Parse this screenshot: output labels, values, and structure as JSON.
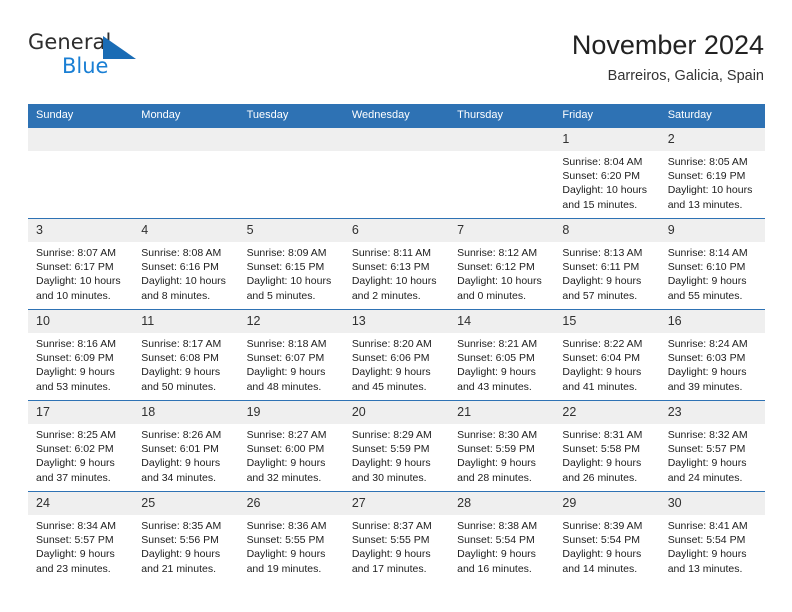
{
  "brand": {
    "name_top": "General",
    "name_bottom": "Blue",
    "triangle_icon": "triangle-logo-icon",
    "color_top": "#2d2d2d",
    "color_bottom": "#1a7fd4",
    "color_triangle": "#1a6cb5"
  },
  "header": {
    "title": "November 2024",
    "subtitle": "Barreiros, Galicia, Spain"
  },
  "theme": {
    "header_blue": "#2e72b4",
    "daynum_gray": "#efefef",
    "cell_white": "#ffffff",
    "text_dark": "#1d1d1d"
  },
  "weekday_headers": [
    "Sunday",
    "Monday",
    "Tuesday",
    "Wednesday",
    "Thursday",
    "Friday",
    "Saturday"
  ],
  "weeks": [
    {
      "days": [
        {
          "empty": true,
          "num": "",
          "sunrise": "",
          "sunset": "",
          "daylight_1": "",
          "daylight_2": ""
        },
        {
          "empty": true,
          "num": "",
          "sunrise": "",
          "sunset": "",
          "daylight_1": "",
          "daylight_2": ""
        },
        {
          "empty": true,
          "num": "",
          "sunrise": "",
          "sunset": "",
          "daylight_1": "",
          "daylight_2": ""
        },
        {
          "empty": true,
          "num": "",
          "sunrise": "",
          "sunset": "",
          "daylight_1": "",
          "daylight_2": ""
        },
        {
          "empty": true,
          "num": "",
          "sunrise": "",
          "sunset": "",
          "daylight_1": "",
          "daylight_2": ""
        },
        {
          "empty": false,
          "num": "1",
          "sunrise": "Sunrise: 8:04 AM",
          "sunset": "Sunset: 6:20 PM",
          "daylight_1": "Daylight: 10 hours",
          "daylight_2": "and 15 minutes."
        },
        {
          "empty": false,
          "num": "2",
          "sunrise": "Sunrise: 8:05 AM",
          "sunset": "Sunset: 6:19 PM",
          "daylight_1": "Daylight: 10 hours",
          "daylight_2": "and 13 minutes."
        }
      ]
    },
    {
      "days": [
        {
          "empty": false,
          "num": "3",
          "sunrise": "Sunrise: 8:07 AM",
          "sunset": "Sunset: 6:17 PM",
          "daylight_1": "Daylight: 10 hours",
          "daylight_2": "and 10 minutes."
        },
        {
          "empty": false,
          "num": "4",
          "sunrise": "Sunrise: 8:08 AM",
          "sunset": "Sunset: 6:16 PM",
          "daylight_1": "Daylight: 10 hours",
          "daylight_2": "and 8 minutes."
        },
        {
          "empty": false,
          "num": "5",
          "sunrise": "Sunrise: 8:09 AM",
          "sunset": "Sunset: 6:15 PM",
          "daylight_1": "Daylight: 10 hours",
          "daylight_2": "and 5 minutes."
        },
        {
          "empty": false,
          "num": "6",
          "sunrise": "Sunrise: 8:11 AM",
          "sunset": "Sunset: 6:13 PM",
          "daylight_1": "Daylight: 10 hours",
          "daylight_2": "and 2 minutes."
        },
        {
          "empty": false,
          "num": "7",
          "sunrise": "Sunrise: 8:12 AM",
          "sunset": "Sunset: 6:12 PM",
          "daylight_1": "Daylight: 10 hours",
          "daylight_2": "and 0 minutes."
        },
        {
          "empty": false,
          "num": "8",
          "sunrise": "Sunrise: 8:13 AM",
          "sunset": "Sunset: 6:11 PM",
          "daylight_1": "Daylight: 9 hours",
          "daylight_2": "and 57 minutes."
        },
        {
          "empty": false,
          "num": "9",
          "sunrise": "Sunrise: 8:14 AM",
          "sunset": "Sunset: 6:10 PM",
          "daylight_1": "Daylight: 9 hours",
          "daylight_2": "and 55 minutes."
        }
      ]
    },
    {
      "days": [
        {
          "empty": false,
          "num": "10",
          "sunrise": "Sunrise: 8:16 AM",
          "sunset": "Sunset: 6:09 PM",
          "daylight_1": "Daylight: 9 hours",
          "daylight_2": "and 53 minutes."
        },
        {
          "empty": false,
          "num": "11",
          "sunrise": "Sunrise: 8:17 AM",
          "sunset": "Sunset: 6:08 PM",
          "daylight_1": "Daylight: 9 hours",
          "daylight_2": "and 50 minutes."
        },
        {
          "empty": false,
          "num": "12",
          "sunrise": "Sunrise: 8:18 AM",
          "sunset": "Sunset: 6:07 PM",
          "daylight_1": "Daylight: 9 hours",
          "daylight_2": "and 48 minutes."
        },
        {
          "empty": false,
          "num": "13",
          "sunrise": "Sunrise: 8:20 AM",
          "sunset": "Sunset: 6:06 PM",
          "daylight_1": "Daylight: 9 hours",
          "daylight_2": "and 45 minutes."
        },
        {
          "empty": false,
          "num": "14",
          "sunrise": "Sunrise: 8:21 AM",
          "sunset": "Sunset: 6:05 PM",
          "daylight_1": "Daylight: 9 hours",
          "daylight_2": "and 43 minutes."
        },
        {
          "empty": false,
          "num": "15",
          "sunrise": "Sunrise: 8:22 AM",
          "sunset": "Sunset: 6:04 PM",
          "daylight_1": "Daylight: 9 hours",
          "daylight_2": "and 41 minutes."
        },
        {
          "empty": false,
          "num": "16",
          "sunrise": "Sunrise: 8:24 AM",
          "sunset": "Sunset: 6:03 PM",
          "daylight_1": "Daylight: 9 hours",
          "daylight_2": "and 39 minutes."
        }
      ]
    },
    {
      "days": [
        {
          "empty": false,
          "num": "17",
          "sunrise": "Sunrise: 8:25 AM",
          "sunset": "Sunset: 6:02 PM",
          "daylight_1": "Daylight: 9 hours",
          "daylight_2": "and 37 minutes."
        },
        {
          "empty": false,
          "num": "18",
          "sunrise": "Sunrise: 8:26 AM",
          "sunset": "Sunset: 6:01 PM",
          "daylight_1": "Daylight: 9 hours",
          "daylight_2": "and 34 minutes."
        },
        {
          "empty": false,
          "num": "19",
          "sunrise": "Sunrise: 8:27 AM",
          "sunset": "Sunset: 6:00 PM",
          "daylight_1": "Daylight: 9 hours",
          "daylight_2": "and 32 minutes."
        },
        {
          "empty": false,
          "num": "20",
          "sunrise": "Sunrise: 8:29 AM",
          "sunset": "Sunset: 5:59 PM",
          "daylight_1": "Daylight: 9 hours",
          "daylight_2": "and 30 minutes."
        },
        {
          "empty": false,
          "num": "21",
          "sunrise": "Sunrise: 8:30 AM",
          "sunset": "Sunset: 5:59 PM",
          "daylight_1": "Daylight: 9 hours",
          "daylight_2": "and 28 minutes."
        },
        {
          "empty": false,
          "num": "22",
          "sunrise": "Sunrise: 8:31 AM",
          "sunset": "Sunset: 5:58 PM",
          "daylight_1": "Daylight: 9 hours",
          "daylight_2": "and 26 minutes."
        },
        {
          "empty": false,
          "num": "23",
          "sunrise": "Sunrise: 8:32 AM",
          "sunset": "Sunset: 5:57 PM",
          "daylight_1": "Daylight: 9 hours",
          "daylight_2": "and 24 minutes."
        }
      ]
    },
    {
      "days": [
        {
          "empty": false,
          "num": "24",
          "sunrise": "Sunrise: 8:34 AM",
          "sunset": "Sunset: 5:57 PM",
          "daylight_1": "Daylight: 9 hours",
          "daylight_2": "and 23 minutes."
        },
        {
          "empty": false,
          "num": "25",
          "sunrise": "Sunrise: 8:35 AM",
          "sunset": "Sunset: 5:56 PM",
          "daylight_1": "Daylight: 9 hours",
          "daylight_2": "and 21 minutes."
        },
        {
          "empty": false,
          "num": "26",
          "sunrise": "Sunrise: 8:36 AM",
          "sunset": "Sunset: 5:55 PM",
          "daylight_1": "Daylight: 9 hours",
          "daylight_2": "and 19 minutes."
        },
        {
          "empty": false,
          "num": "27",
          "sunrise": "Sunrise: 8:37 AM",
          "sunset": "Sunset: 5:55 PM",
          "daylight_1": "Daylight: 9 hours",
          "daylight_2": "and 17 minutes."
        },
        {
          "empty": false,
          "num": "28",
          "sunrise": "Sunrise: 8:38 AM",
          "sunset": "Sunset: 5:54 PM",
          "daylight_1": "Daylight: 9 hours",
          "daylight_2": "and 16 minutes."
        },
        {
          "empty": false,
          "num": "29",
          "sunrise": "Sunrise: 8:39 AM",
          "sunset": "Sunset: 5:54 PM",
          "daylight_1": "Daylight: 9 hours",
          "daylight_2": "and 14 minutes."
        },
        {
          "empty": false,
          "num": "30",
          "sunrise": "Sunrise: 8:41 AM",
          "sunset": "Sunset: 5:54 PM",
          "daylight_1": "Daylight: 9 hours",
          "daylight_2": "and 13 minutes."
        }
      ]
    }
  ]
}
